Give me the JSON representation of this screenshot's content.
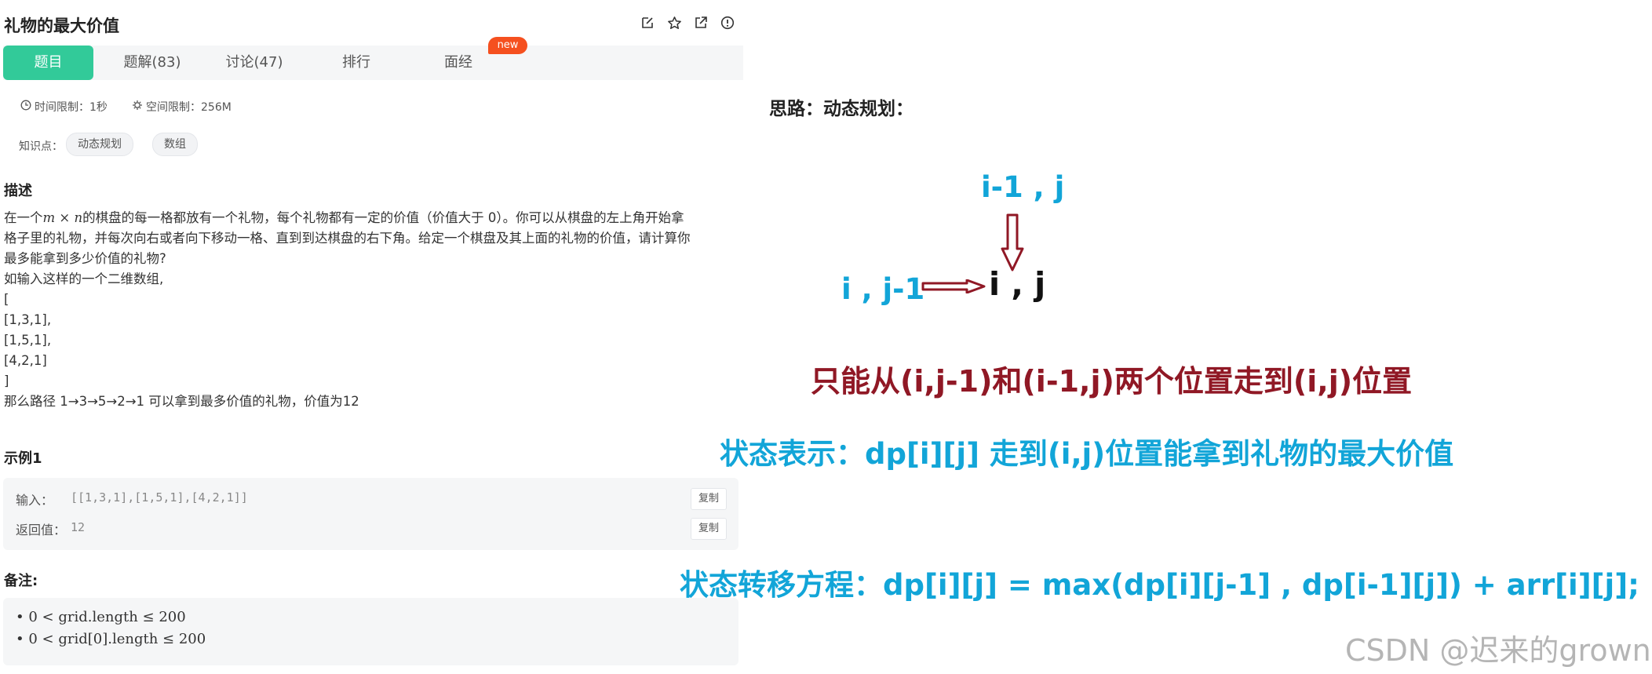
{
  "header": {
    "title": "礼物的最大价值",
    "icons": [
      "edit-icon",
      "star-icon",
      "share-icon",
      "info-icon"
    ]
  },
  "tabs": [
    {
      "label": "题目",
      "active": true
    },
    {
      "label": "题解(83)"
    },
    {
      "label": "讨论(47)"
    },
    {
      "label": "排行"
    },
    {
      "label": "面经"
    }
  ],
  "new_badge": "new",
  "meta": {
    "time_limit": "时间限制：1秒",
    "space_limit": "空间限制：256M"
  },
  "knowledge": {
    "label": "知识点：",
    "tags": [
      "动态规划",
      "数组"
    ]
  },
  "description": {
    "heading": "描述",
    "line1_pre": "在一个",
    "line1_math": "m × n",
    "line1_post": "的棋盘的每一格都放有一个礼物，每个礼物都有一定的价值（价值大于 0）。你可以从棋盘的左上角开始拿",
    "line2": "格子里的礼物，并每次向右或者向下移动一格、直到到达棋盘的右下角。给定一个棋盘及其上面的礼物的价值，请计算你",
    "line3": "最多能拿到多少价值的礼物?",
    "line4": "如输入这样的一个二维数组,",
    "line5": "[",
    "line6": "[1,3,1],",
    "line7": "[1,5,1],",
    "line8": "[4,2,1]",
    "line9": "]",
    "line10": "那么路径 1→3→5→2→1 可以拿到最多价值的礼物，价值为12"
  },
  "example": {
    "heading": "示例1",
    "input_label": "输入：",
    "input_value": "[[1,3,1],[1,5,1],[4,2,1]]",
    "output_label": "返回值：",
    "output_value": "12",
    "copy_label": "复制"
  },
  "notes": {
    "heading": "备注:",
    "items": [
      "0 < grid.length ≤ 200",
      "0 < grid[0].length ≤ 200"
    ]
  },
  "explanation": {
    "heading": "思路：动态规划：",
    "top_cell": "i-1 , j",
    "left_cell": "i , j-1",
    "center_cell": "i , j",
    "red_note": "只能从(i,j-1)和(i-1,j)两个位置走到(i,j)位置",
    "state_def": "状态表示：dp[i][j] 走到(i,j)位置能拿到礼物的最大价值",
    "transition": "状态转移方程：dp[i][j] = max(dp[i][j-1] , dp[i-1][j]) + arr[i][j];"
  },
  "watermark": "CSDN @迟来的grown",
  "colors": {
    "active_tab": "#32ca99",
    "badge": "#f5501f",
    "blue_text": "#12a5d8",
    "red_text": "#901825",
    "arrow": "#901825"
  }
}
